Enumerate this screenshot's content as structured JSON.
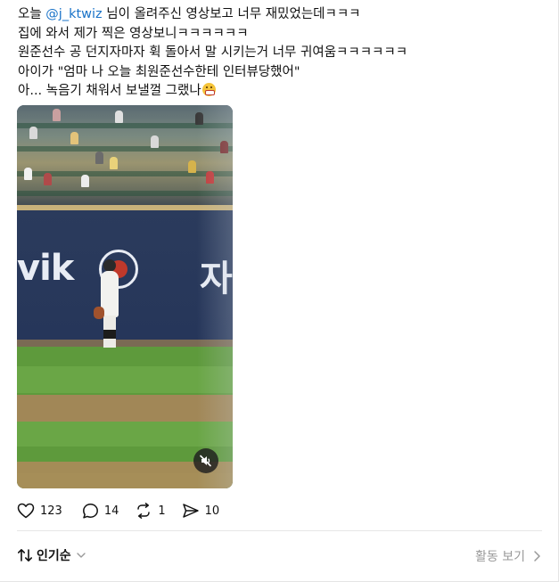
{
  "post": {
    "line1_prefix": "오늘 ",
    "mention": "@j_ktwiz",
    "line1_suffix": " 님이 올려주신 영상보고 너무 재밌었는데ㅋㅋㅋ",
    "line2": "집에 와서 제가 찍은 영상보니ㅋㅋㅋㅋㅋㅋ",
    "line3": "원준선수 공 던지자마자 휙 돌아서 말 시키는거 너무 귀여움ㅋㅋㅋㅋㅋㅋ",
    "line4": "아이가 \"엄마 나 오늘 최원준선수한테 인터뷰당했어\"",
    "line5": "아... 녹음기 채워서 보낼껄 그랬나",
    "emoji": "grimacing-face-emoji"
  },
  "video": {
    "wall_text_left": "vik",
    "wall_text_right": "자",
    "mute_icon": "speaker-muted-icon"
  },
  "actions": {
    "likes": "123",
    "replies": "14",
    "reposts": "1",
    "shares": "10"
  },
  "sort": {
    "label": "인기순"
  },
  "activity": {
    "label": "활동 보기"
  },
  "colors": {
    "mention": "#1a73c8",
    "muted_text": "#999999"
  }
}
